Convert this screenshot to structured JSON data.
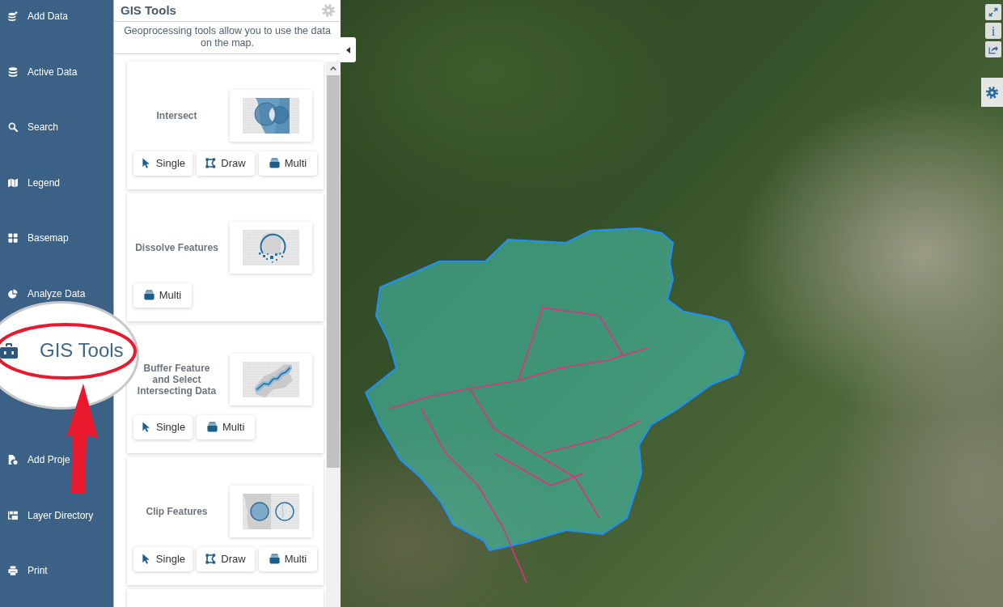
{
  "sidebar": {
    "items": [
      {
        "label": "Add Data"
      },
      {
        "label": "Active Data"
      },
      {
        "label": "Search"
      },
      {
        "label": "Legend"
      },
      {
        "label": "Basemap"
      },
      {
        "label": "Analyze Data"
      },
      {
        "label": "Add Proje"
      },
      {
        "label": "Layer Directory"
      },
      {
        "label": "Print"
      }
    ]
  },
  "panel": {
    "title": "GIS Tools",
    "description": "Geoprocessing tools allow you to use the data on the map.",
    "tools": [
      {
        "name": "Intersect",
        "buttons": [
          {
            "kind": "single",
            "label": "Single"
          },
          {
            "kind": "draw",
            "label": "Draw"
          },
          {
            "kind": "multi",
            "label": "Multi"
          }
        ]
      },
      {
        "name": "Dissolve Features",
        "buttons": [
          {
            "kind": "multi",
            "label": "Multi"
          }
        ]
      },
      {
        "name": "Buffer Feature and Select Intersecting Data",
        "buttons": [
          {
            "kind": "single",
            "label": "Single"
          },
          {
            "kind": "multi",
            "label": "Multi"
          }
        ]
      },
      {
        "name": "Clip Features",
        "buttons": [
          {
            "kind": "single",
            "label": "Single"
          },
          {
            "kind": "draw",
            "label": "Draw"
          },
          {
            "kind": "multi",
            "label": "Multi"
          }
        ]
      }
    ]
  },
  "map": {
    "controls": [
      {
        "kind": "expand"
      },
      {
        "kind": "info",
        "label": "i"
      },
      {
        "kind": "share"
      }
    ]
  },
  "callout": {
    "label": "GIS Tools"
  }
}
